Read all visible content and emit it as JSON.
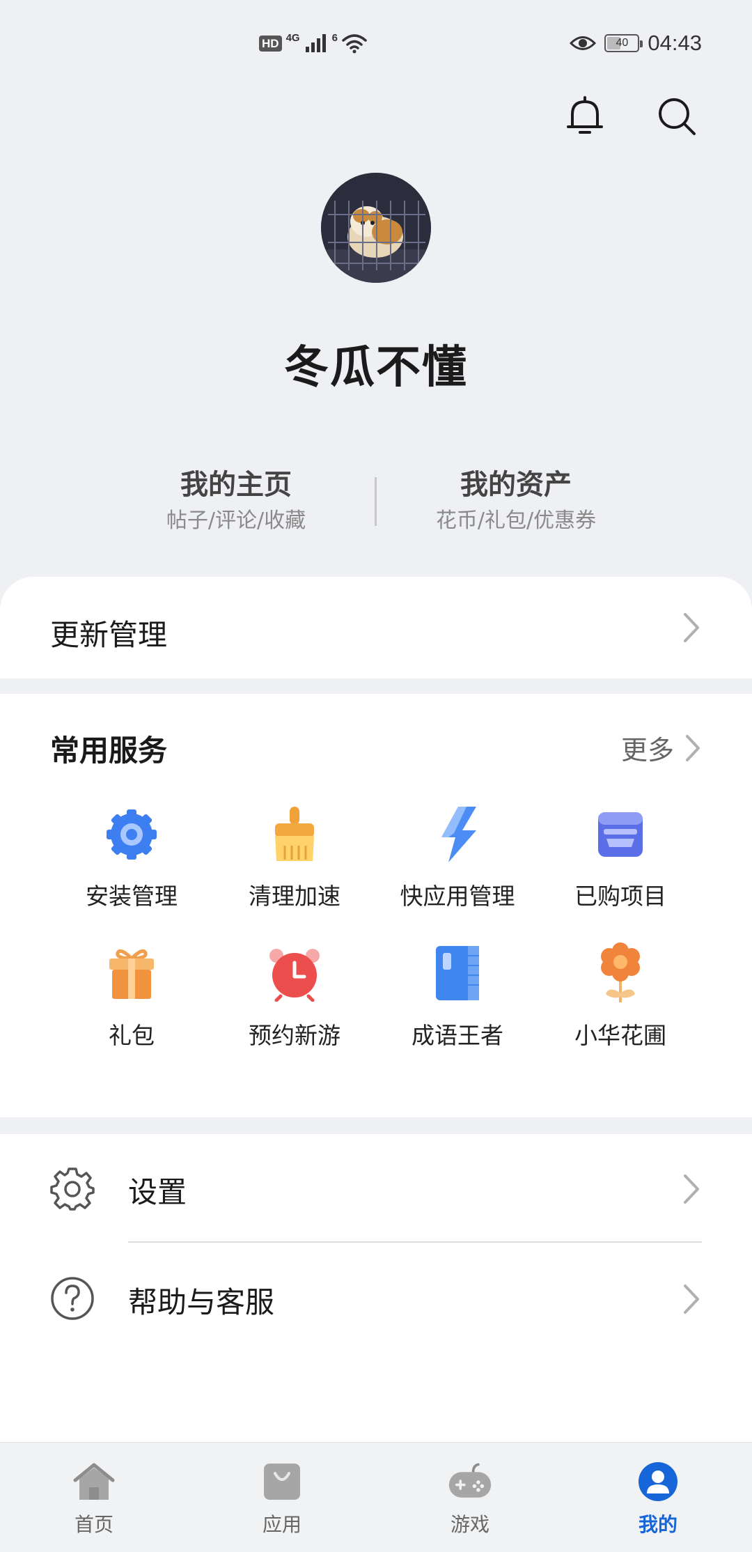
{
  "status_bar": {
    "hd_label": "HD",
    "network_label": "4G",
    "wifi_label": "6",
    "battery_level": "40",
    "time": "04:43",
    "icons": [
      "hd-icon",
      "signal-icon",
      "wifi-icon",
      "eye-comfort-icon",
      "battery-icon"
    ]
  },
  "header": {
    "icons": [
      "bell-icon",
      "search-icon"
    ]
  },
  "profile": {
    "username": "冬瓜不懂",
    "links": [
      {
        "title": "我的主页",
        "subtitle": "帖子/评论/收藏"
      },
      {
        "title": "我的资产",
        "subtitle": "花币/礼包/优惠券"
      }
    ]
  },
  "update": {
    "label": "更新管理"
  },
  "services": {
    "title": "常用服务",
    "more_label": "更多",
    "items": [
      {
        "label": "安装管理",
        "icon": "gear-install-icon"
      },
      {
        "label": "清理加速",
        "icon": "broom-icon"
      },
      {
        "label": "快应用管理",
        "icon": "lightning-icon"
      },
      {
        "label": "已购项目",
        "icon": "purchased-box-icon"
      },
      {
        "label": "礼包",
        "icon": "gift-icon"
      },
      {
        "label": "预约新游",
        "icon": "alarm-clock-icon"
      },
      {
        "label": "成语王者",
        "icon": "book-icon"
      },
      {
        "label": "小华花圃",
        "icon": "flower-icon"
      }
    ]
  },
  "settings_rows": [
    {
      "label": "设置",
      "icon": "settings-gear-icon"
    },
    {
      "label": "帮助与客服",
      "icon": "help-question-icon"
    }
  ],
  "bottom_nav": {
    "items": [
      {
        "label": "首页",
        "icon": "home-icon",
        "active": false
      },
      {
        "label": "应用",
        "icon": "app-store-bag-icon",
        "active": false
      },
      {
        "label": "游戏",
        "icon": "gamepad-icon",
        "active": false
      },
      {
        "label": "我的",
        "icon": "profile-icon",
        "active": true
      }
    ]
  },
  "colors": {
    "accent": "#1766d9",
    "background": "#eef0f3"
  }
}
